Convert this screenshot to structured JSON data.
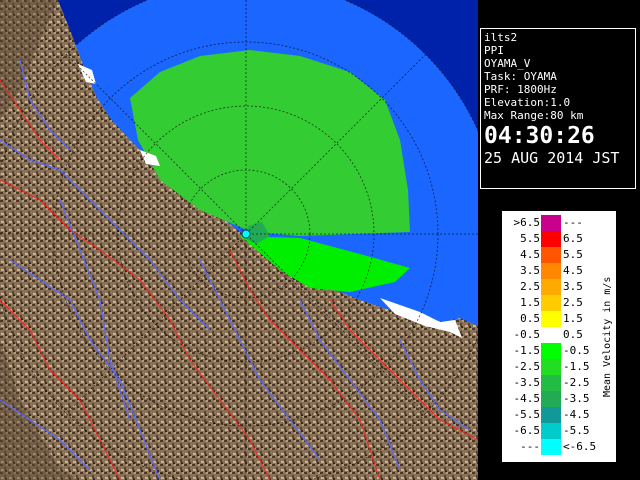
{
  "info_panel": {
    "lines": [
      "ilts2",
      "PPI",
      "OYAMA_V",
      "Task: OYAMA",
      "PRF: 1800Hz",
      "Elevation:1.0",
      "Max Range:80 km"
    ],
    "time": "04:30:26",
    "date": "25 AUG 2014 JST"
  },
  "legend": {
    "unit": "Mean Velocity in m/s",
    "rows": [
      {
        "lo": ">6.5",
        "hi": "---",
        "color": "#c8008c"
      },
      {
        "lo": "5.5",
        "hi": "6.5",
        "color": "#ff0000"
      },
      {
        "lo": "4.5",
        "hi": "5.5",
        "color": "#ff5500"
      },
      {
        "lo": "3.5",
        "hi": "4.5",
        "color": "#ff8800"
      },
      {
        "lo": "2.5",
        "hi": "3.5",
        "color": "#ffaa00"
      },
      {
        "lo": "1.5",
        "hi": "2.5",
        "color": "#ffcc00"
      },
      {
        "lo": "0.5",
        "hi": "1.5",
        "color": "#ffff00"
      },
      {
        "lo": "-0.5",
        "hi": "0.5",
        "color": "#ffffff"
      },
      {
        "lo": "-1.5",
        "hi": "-0.5",
        "color": "#00ff00"
      },
      {
        "lo": "-2.5",
        "hi": "-1.5",
        "color": "#22dd22"
      },
      {
        "lo": "-3.5",
        "hi": "-2.5",
        "color": "#22bb44"
      },
      {
        "lo": "-4.5",
        "hi": "-3.5",
        "color": "#22aa55"
      },
      {
        "lo": "-5.5",
        "hi": "-4.5",
        "color": "#119999"
      },
      {
        "lo": "-6.5",
        "hi": "-5.5",
        "color": "#00cccc"
      },
      {
        "lo": "---",
        "hi": "<-6.5",
        "color": "#00ffff"
      }
    ]
  },
  "colors": {
    "water": "#1a66ff",
    "outer_water": "#0022aa",
    "land": "#8a7258",
    "land_dark": "#3a2a1a",
    "rivers": "#5a6aff",
    "borders": "#ff2020",
    "echo_main": "#33cc33",
    "echo_bright": "#00ee00"
  }
}
